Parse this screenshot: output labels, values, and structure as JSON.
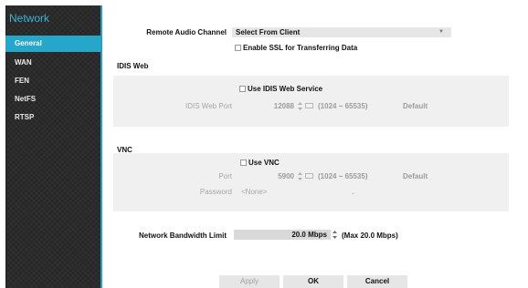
{
  "sidebar": {
    "title": "Network",
    "items": [
      {
        "label": "General",
        "active": true
      },
      {
        "label": "WAN",
        "active": false
      },
      {
        "label": "FEN",
        "active": false
      },
      {
        "label": "NetFS",
        "active": false
      },
      {
        "label": "RTSP",
        "active": false
      }
    ]
  },
  "remote_audio": {
    "label": "Remote Audio Channel",
    "value": "Select From Client"
  },
  "ssl": {
    "label": "Enable SSL for Transferring Data",
    "checked": false
  },
  "idis_web": {
    "section_title": "IDIS Web",
    "use_label": "Use IDIS Web Service",
    "use_checked": false,
    "port_label": "IDIS Web Port",
    "port_value": "12088",
    "port_range": "(1024 ~ 65535)",
    "default_label": "Default"
  },
  "vnc": {
    "section_title": "VNC",
    "use_label": "Use VNC",
    "use_checked": false,
    "port_label": "Port",
    "port_value": "5900",
    "port_range": "(1024 ~ 65535)",
    "default_label": "Default",
    "password_label": "Password",
    "password_value": "<None>"
  },
  "bandwidth": {
    "label": "Network Bandwidth Limit",
    "value": "20.0 Mbps",
    "max_text": "(Max 20.0 Mbps)"
  },
  "buttons": {
    "apply": "Apply",
    "ok": "OK",
    "cancel": "Cancel"
  },
  "colors": {
    "accent": "#25a7c9",
    "sidebar_bg": "#2b2b2b",
    "panel_bg": "#f0f0f0"
  }
}
